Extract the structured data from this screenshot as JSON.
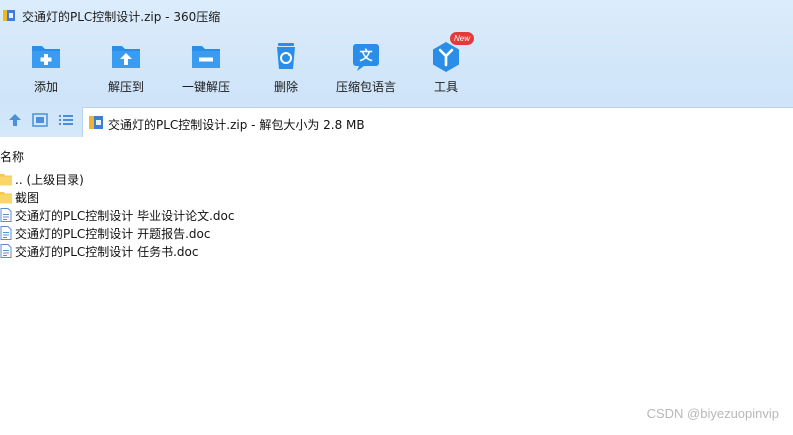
{
  "window": {
    "title": "交通灯的PLC控制设计.zip - 360压缩"
  },
  "toolbar": {
    "items": [
      {
        "label": "添加",
        "icon": "add-folder-icon"
      },
      {
        "label": "解压到",
        "icon": "extract-to-folder-icon"
      },
      {
        "label": "一键解压",
        "icon": "one-click-extract-icon"
      },
      {
        "label": "删除",
        "icon": "recycle-bin-icon"
      },
      {
        "label": "压缩包语言",
        "icon": "archive-language-icon"
      },
      {
        "label": "工具",
        "icon": "tools-icon",
        "badge": "New"
      }
    ]
  },
  "navbar": {
    "address": "交通灯的PLC控制设计.zip - 解包大小为 2.8 MB"
  },
  "file_list": {
    "column_name": "名称",
    "rows": [
      {
        "name": ".. (上级目录)",
        "type": "folder"
      },
      {
        "name": "截图",
        "type": "folder"
      },
      {
        "name": "交通灯的PLC控制设计 毕业设计论文.doc",
        "type": "doc"
      },
      {
        "name": "交通灯的PLC控制设计 开题报告.doc",
        "type": "doc"
      },
      {
        "name": "交通灯的PLC控制设计 任务书.doc",
        "type": "doc"
      }
    ]
  },
  "watermark": "CSDN @biyezuopinvip",
  "colors": {
    "accent": "#2a8ee8",
    "chrome_bg": "#d3e7fa",
    "badge": "#e23b3b",
    "folder": "#f5c84c"
  }
}
